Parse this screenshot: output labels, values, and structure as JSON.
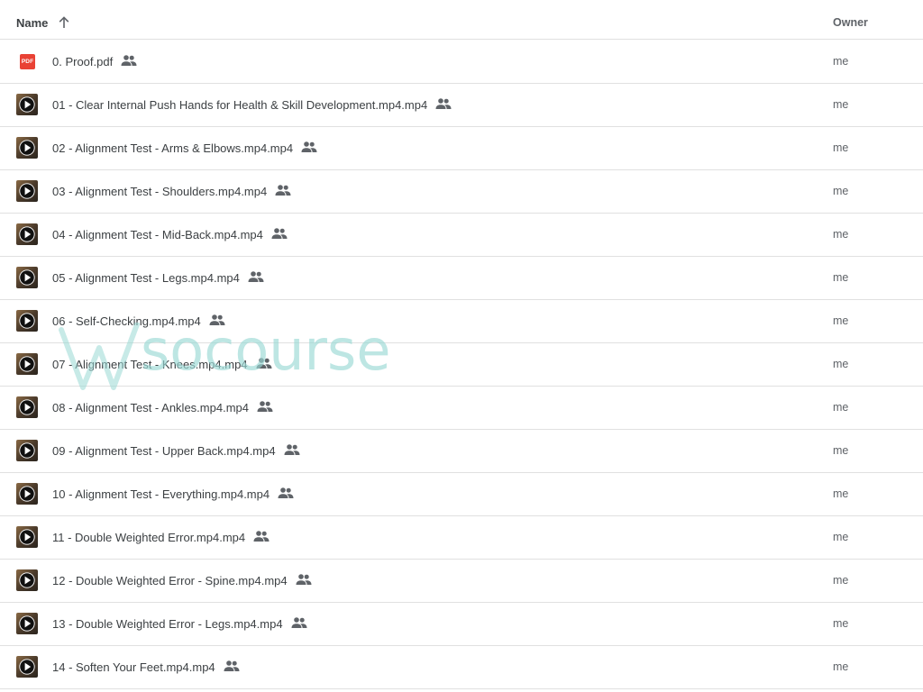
{
  "header": {
    "name_label": "Name",
    "owner_label": "Owner",
    "sort_icon": "arrow-up-icon"
  },
  "files": [
    {
      "name": "0. Proof.pdf",
      "type": "pdf",
      "owner": "me",
      "shared": true
    },
    {
      "name": "01 - Clear Internal Push Hands for Health & Skill Development.mp4.mp4",
      "type": "video",
      "owner": "me",
      "shared": true
    },
    {
      "name": "02 - Alignment Test - Arms & Elbows.mp4.mp4",
      "type": "video",
      "owner": "me",
      "shared": true
    },
    {
      "name": "03 - Alignment Test - Shoulders.mp4.mp4",
      "type": "video",
      "owner": "me",
      "shared": true
    },
    {
      "name": "04 - Alignment Test - Mid-Back.mp4.mp4",
      "type": "video",
      "owner": "me",
      "shared": true
    },
    {
      "name": "05 - Alignment Test - Legs.mp4.mp4",
      "type": "video",
      "owner": "me",
      "shared": true
    },
    {
      "name": "06 - Self-Checking.mp4.mp4",
      "type": "video",
      "owner": "me",
      "shared": true
    },
    {
      "name": "07 - Alignment Test - Knees.mp4.mp4",
      "type": "video",
      "owner": "me",
      "shared": true
    },
    {
      "name": "08 - Alignment Test - Ankles.mp4.mp4",
      "type": "video",
      "owner": "me",
      "shared": true
    },
    {
      "name": "09 - Alignment Test - Upper Back.mp4.mp4",
      "type": "video",
      "owner": "me",
      "shared": true
    },
    {
      "name": "10 - Alignment Test - Everything.mp4.mp4",
      "type": "video",
      "owner": "me",
      "shared": true
    },
    {
      "name": "11 - Double Weighted Error.mp4.mp4",
      "type": "video",
      "owner": "me",
      "shared": true
    },
    {
      "name": "12 - Double Weighted Error - Spine.mp4.mp4",
      "type": "video",
      "owner": "me",
      "shared": true
    },
    {
      "name": "13 - Double Weighted Error - Legs.mp4.mp4",
      "type": "video",
      "owner": "me",
      "shared": true
    },
    {
      "name": "14 - Soften Your Feet.mp4.mp4",
      "type": "video",
      "owner": "me",
      "shared": true
    }
  ],
  "icons": {
    "pdf_label": "PDF",
    "pdf_color": "#e94235",
    "shared_icon": "people-icon",
    "video_icon": "video-play-icon"
  },
  "watermark": {
    "text": "socourse",
    "color": "#9ad9d5"
  }
}
